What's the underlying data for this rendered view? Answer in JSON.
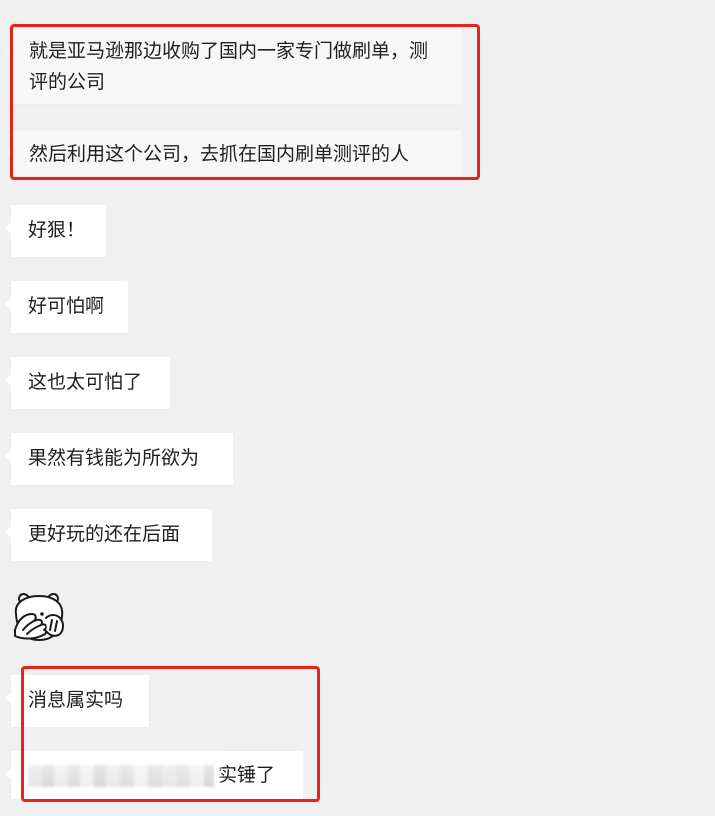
{
  "messages": [
    {
      "text": "就是亚马逊那边收购了国内一家专门做刷单，测评的公司"
    },
    {
      "text": "然后利用这个公司，去抓在国内刷单测评的人"
    },
    {
      "text": "好狠！"
    },
    {
      "text": "好可怕啊"
    },
    {
      "text": "这也太可怕了"
    },
    {
      "text": "果然有钱能为所欲为"
    },
    {
      "text": "更好玩的还在后面"
    },
    {
      "sticker": "covering-face-bear-sticker-icon"
    },
    {
      "text": "消息属实吗"
    },
    {
      "text": "实锤了"
    }
  ],
  "colors": {
    "background": "#f0f0f0",
    "bubble": "#ffffff",
    "highlight": "#e8231c"
  }
}
